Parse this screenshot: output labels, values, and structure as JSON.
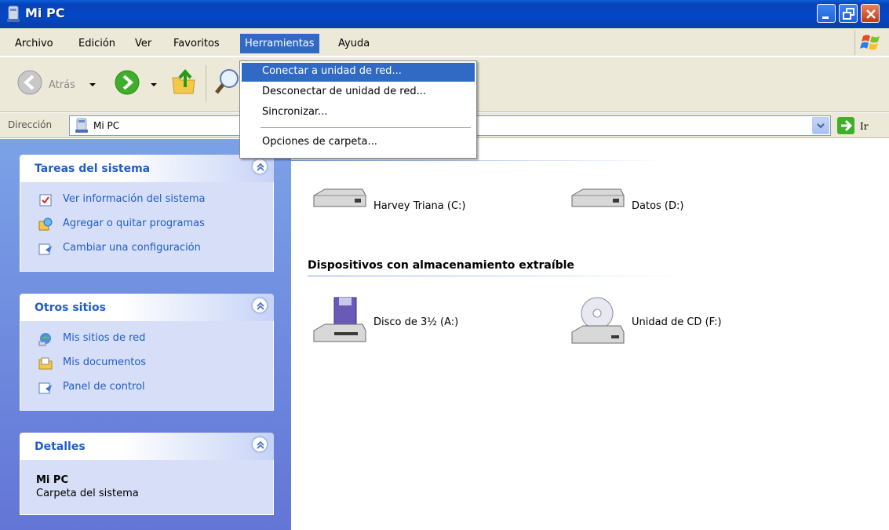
{
  "window": {
    "title": "Mi PC"
  },
  "menubar": {
    "items": [
      "Archivo",
      "Edición",
      "Ver",
      "Favoritos",
      "Herramientas",
      "Ayuda"
    ],
    "active": "Herramientas"
  },
  "toolbar": {
    "back_label": "Atrás"
  },
  "addressbar": {
    "label": "Dirección",
    "value": "Mi PC",
    "go_label": "Ir"
  },
  "tools_menu": {
    "items": [
      {
        "label": "Conectar a unidad de red...",
        "highlighted": true
      },
      {
        "label": "Desconectar de unidad de red..."
      },
      {
        "label": "Sincronizar..."
      },
      {
        "label": "Opciones de carpeta..."
      }
    ]
  },
  "sidebar": {
    "panels": [
      {
        "title": "Tareas del sistema",
        "links": [
          "Ver información del sistema",
          "Agregar o quitar programas",
          "Cambiar una configuración"
        ]
      },
      {
        "title": "Otros sitios",
        "links": [
          "Mis sitios de red",
          "Mis documentos",
          "Panel de control"
        ]
      },
      {
        "title": "Detalles",
        "name": "Mi PC",
        "subtitle": "Carpeta del sistema"
      }
    ]
  },
  "content": {
    "hard_drives": [
      "Harvey Triana (C:)",
      "Datos (D:)"
    ],
    "removable_section_title": "Dispositivos con almacenamiento extraíble",
    "removable": [
      "Disco de 3½ (A:)",
      "Unidad de CD (F:)"
    ]
  },
  "colors": {
    "titlebar": "#0347c7",
    "menu_highlight": "#316ac5",
    "link": "#215dc6",
    "sidebar": "#6375d6"
  }
}
